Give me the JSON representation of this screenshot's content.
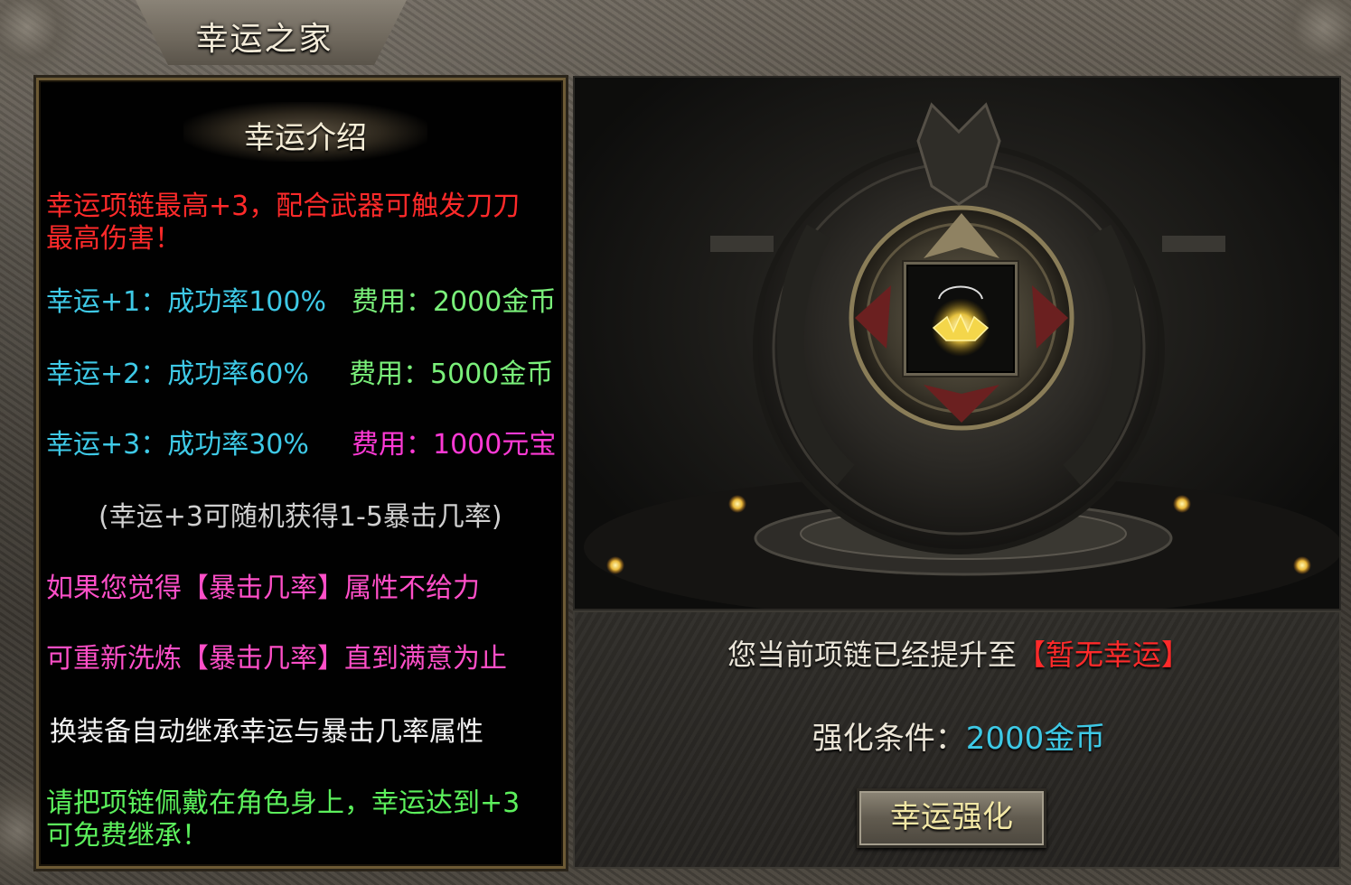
{
  "window": {
    "title": "幸运之家"
  },
  "intro": {
    "header": "幸运介绍",
    "description_line1": "幸运项链最高+3，配合武器可触发刀刀",
    "description_line2": "最高伤害！",
    "tiers": [
      {
        "level": "幸运+1：成功率100%",
        "cost": "费用：2000金币"
      },
      {
        "level": "幸运+2：成功率60%",
        "cost": "费用：5000金币"
      },
      {
        "level": "幸运+3：成功率30%",
        "cost": "费用：1000元宝"
      }
    ],
    "note": "(幸运+3可随机获得1-5暴击几率)",
    "reroll_line1": "如果您觉得【暴击几率】属性不给力",
    "reroll_line2": "可重新洗炼【暴击几率】直到满意为止",
    "inherit_line": "换装备自动继承幸运与暴击几率属性",
    "wear_line1": "请把项链佩戴在角色身上，幸运达到+3",
    "wear_line2": "可免费继承！"
  },
  "status": {
    "prefix": "您当前项链已经提升至",
    "value": "【暂无幸运】"
  },
  "condition": {
    "label": "强化条件：",
    "value": "2000金币"
  },
  "actions": {
    "enhance_label": "幸运强化"
  },
  "colors": {
    "red": "#ff2a2a",
    "cyan": "#3ec9e6",
    "green": "#7af07a",
    "magenta": "#ff3ad6",
    "gold_text": "#f3e8a6"
  },
  "icons": {
    "item": "golden-necklace-icon",
    "emblem": "dragon-emblem-icon"
  }
}
